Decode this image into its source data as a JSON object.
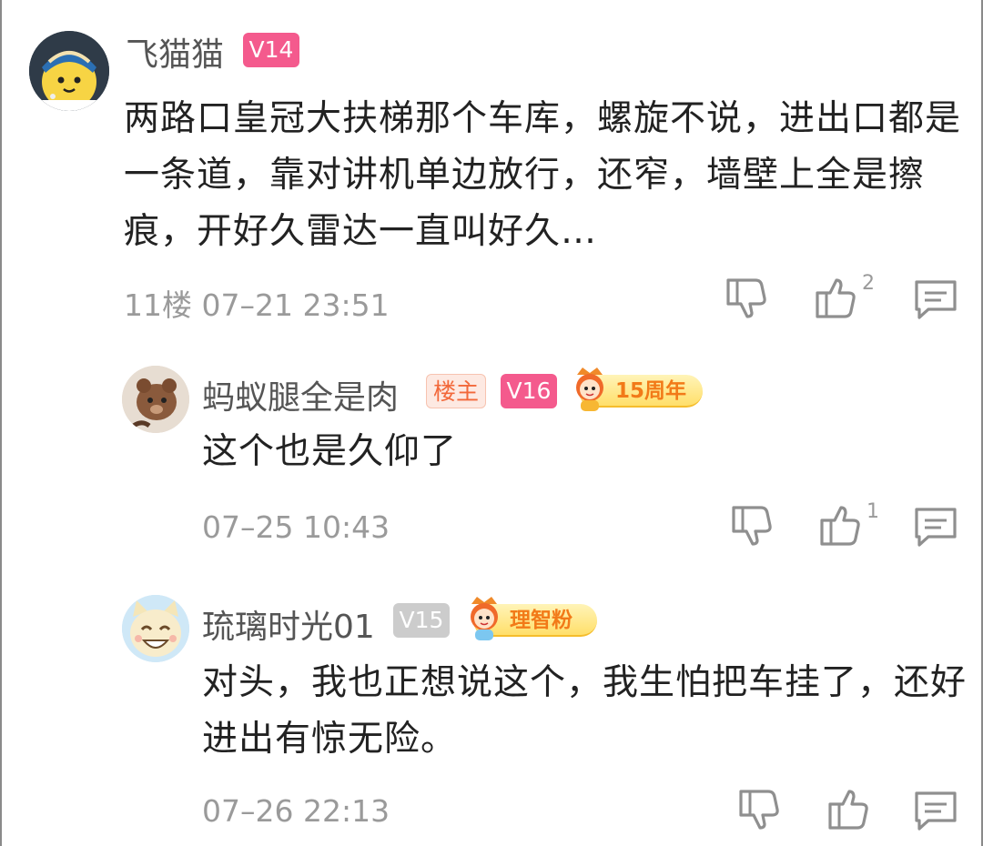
{
  "comments": [
    {
      "user": "飞猫猫",
      "level": "V14",
      "text": "两路口皇冠大扶梯那个车库，螺旋不说，进出口都是一条道，靠对讲机单边放行，还窄，墙壁上全是擦痕，开好久雷达一直叫好久…",
      "floor": "11楼",
      "time": "07–21 23:51",
      "likes": "2",
      "avatar_icon": "cat-pearl-earring-avatar"
    },
    {
      "user": "蚂蚁腿全是肉",
      "owner_badge": "楼主",
      "level": "V16",
      "badge_pill": "15周年",
      "text": "这个也是久仰了",
      "time": "07–25 10:43",
      "likes": "1",
      "avatar_icon": "plush-toy-avatar"
    },
    {
      "user": "琉璃时光01",
      "level": "V15",
      "badge_pill": "理智粉",
      "text": "对头，我也正想说这个，我生怕把车挂了，还好进出有惊无险。",
      "time": "07–26 22:13",
      "likes": "",
      "avatar_icon": "smiling-cat-avatar"
    }
  ],
  "icons": [
    "dislike-icon",
    "like-icon",
    "reply-icon"
  ],
  "colors": {
    "level_pink": "#f45a8d",
    "level_gray": "#cccccc",
    "owner_text": "#f2683a",
    "meta_gray": "#9a9a9a",
    "pill_orange": "#f27a18"
  }
}
